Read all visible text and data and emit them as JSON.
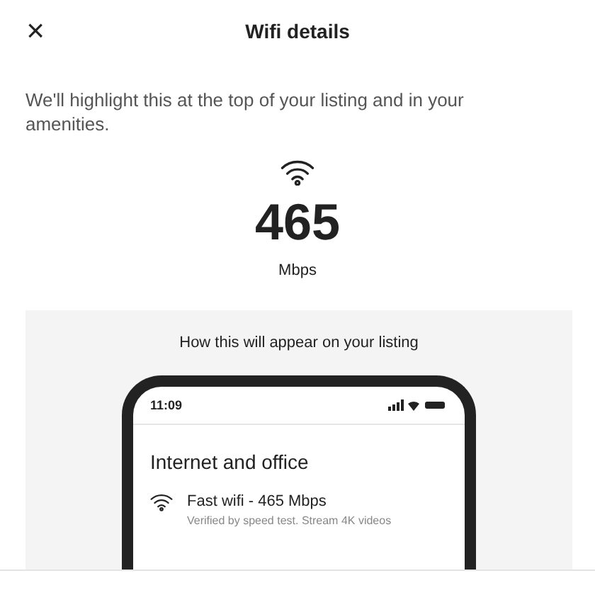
{
  "header": {
    "close": "×",
    "title": "Wifi details"
  },
  "description": "We'll highlight this at the top of your listing and in your amenities.",
  "speed": {
    "value": "465",
    "unit": "Mbps"
  },
  "preview": {
    "heading": "How this will appear on your listing",
    "phone": {
      "time": "11:09",
      "section_title": "Internet and office",
      "amenity": {
        "title": "Fast wifi - 465 Mbps",
        "subtitle": "Verified by speed test. Stream 4K videos"
      }
    }
  }
}
